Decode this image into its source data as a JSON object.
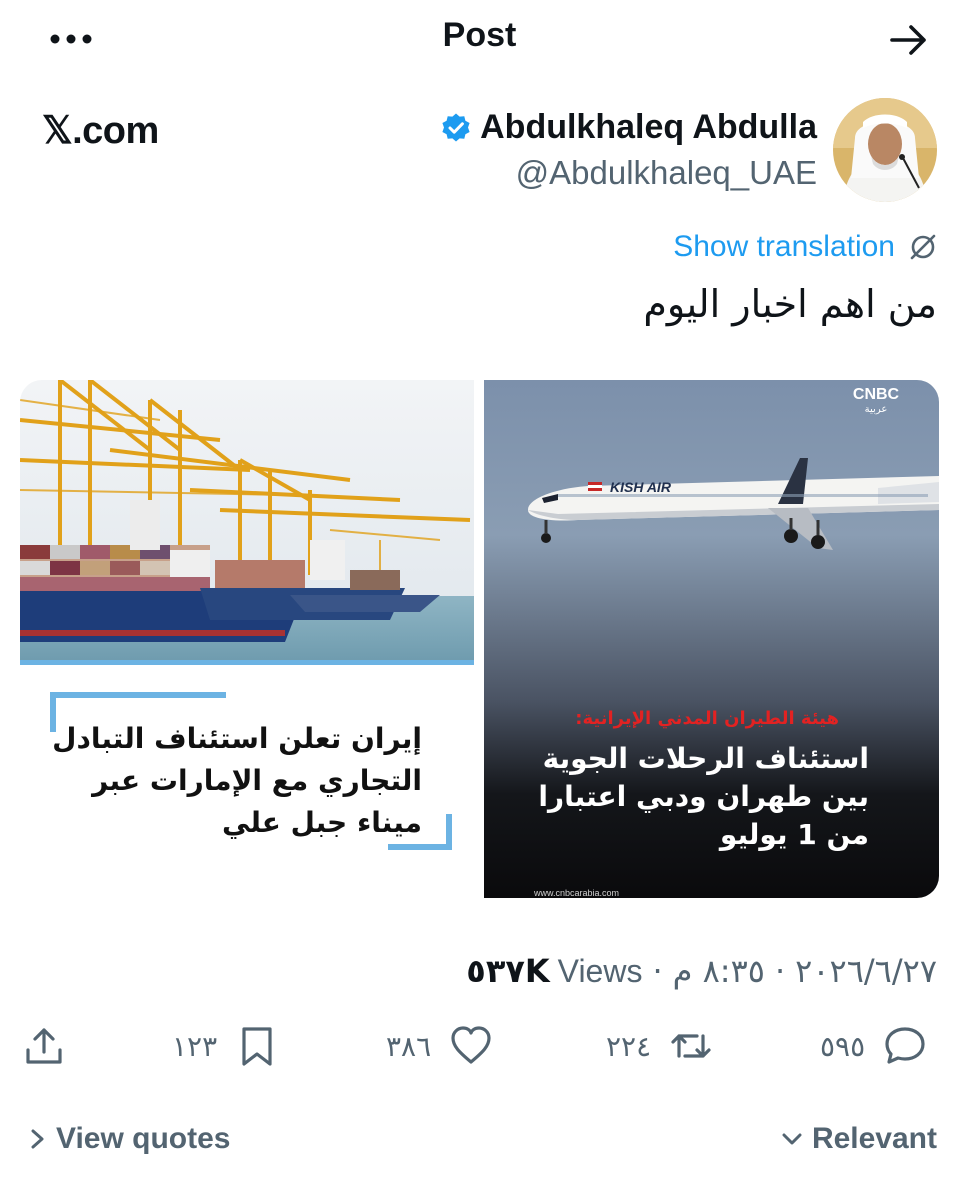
{
  "header": {
    "title": "Post",
    "more_icon": "ellipsis-icon",
    "forward_icon": "arrow-right-icon"
  },
  "brand": {
    "text": "𝕏.com"
  },
  "author": {
    "name": "Abdulkhaleq Abdulla",
    "handle": "@Abdulkhaleq_UAE",
    "verified": true,
    "verified_color": "#1d9bf0"
  },
  "translation": {
    "label": "Show translation",
    "icon": "globe-slash-icon"
  },
  "post": {
    "text": "من اهم اخبار اليوم"
  },
  "media": {
    "left": {
      "caption": "إيران تعلن استئناف التبادل التجاري مع الإمارات عبر ميناء جبل علي",
      "accent_color": "#6cb3e3"
    },
    "right": {
      "logo": "CNBC",
      "logo_sub": "عربية",
      "airline": "KISH AIR",
      "kicker": "هيئة الطيران المدني الإيرانية:",
      "caption": "استئناف الرحلات الجوية بين طهران ودبي اعتبارا من 1 يوليو",
      "source": "www.cnbcarabia.com",
      "kicker_color": "#e22222"
    }
  },
  "meta": {
    "time": "٨:٣٥ م",
    "separator": "·",
    "date": "٢٠٢٦/٦/٢٧",
    "views_count": "٥٣٧K",
    "views_label": "Views"
  },
  "actions": {
    "replies": "٥٩٥",
    "reposts": "٢٢٤",
    "likes": "٣٨٦",
    "bookmarks": "١٢٣"
  },
  "footer": {
    "view_quotes": "View quotes",
    "relevant": "Relevant"
  },
  "colors": {
    "text": "#0f1419",
    "secondary": "#536471",
    "accent": "#1d9bf0"
  }
}
